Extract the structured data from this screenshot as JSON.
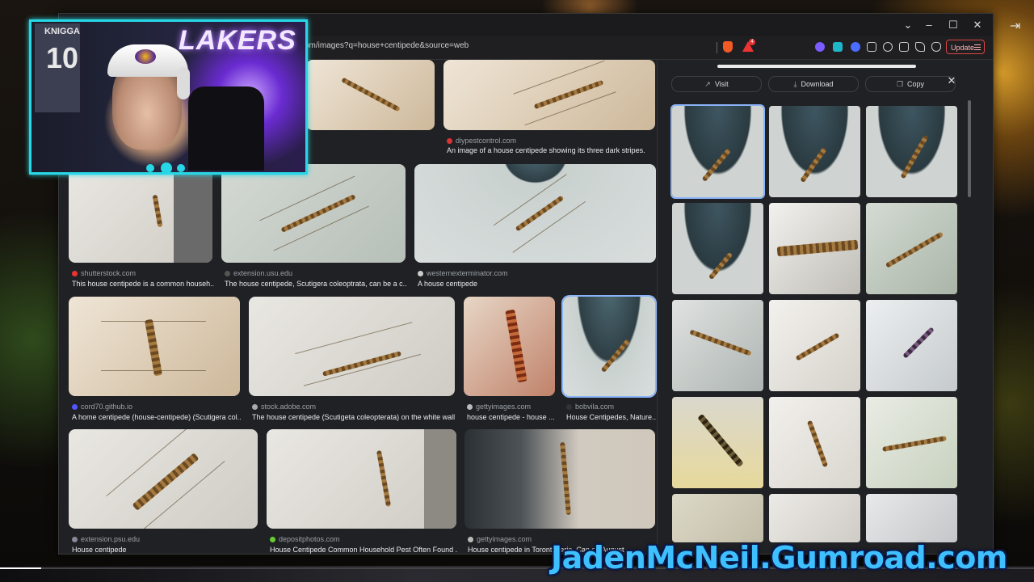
{
  "browser": {
    "url": "om/images?q=house+centipede&source=web",
    "update_label": "Update",
    "alert_count": "4"
  },
  "grid": {
    "rows": [
      [
        {
          "source": "diypestcontrol.com",
          "caption": "An image of a house centipede showing its three dark stripes."
        }
      ],
      [
        {
          "source": "shutterstock.com",
          "caption": "This house centipede is a common househ..."
        },
        {
          "source": "extension.usu.edu",
          "caption": "The house centipede, Scutigera coleoptrata, can be a c..."
        },
        {
          "source": "westernexterminator.com",
          "caption": "A house centipede"
        }
      ],
      [
        {
          "source": "cord70.github.io",
          "caption": "A home centipede (house-centipede) (Scutigera col..."
        },
        {
          "source": "stock.adobe.com",
          "caption": "The house centipede (Scutigeta coleopterata) on the white wall"
        },
        {
          "source": "gettyimages.com",
          "caption": "house centipede - house ..."
        },
        {
          "source": "bobvila.com",
          "caption": "House Centipedes, Nature..."
        }
      ],
      [
        {
          "source": "extension.psu.edu",
          "caption": "House centipede"
        },
        {
          "source": "depositphotos.com",
          "caption": "House Centipede Common Household Pest Often Found ..."
        },
        {
          "source": "gettyimages.com",
          "caption": "House centipede in Toronto,   ario, Can   on August"
        }
      ]
    ]
  },
  "panel": {
    "visit_label": "Visit",
    "download_label": "Download",
    "copy_label": "Copy"
  },
  "overlay": {
    "jersey_name": "KNIGGA",
    "jersey_number": "10",
    "sign_text": "LAKERS",
    "banner_text": "JadenMcNeil.Gumroad.com"
  },
  "player": {
    "progress_fraction": 0.04
  },
  "colors": {
    "accent_cyan": "#27d7e6",
    "banner_blue": "#3ec0ff",
    "selection_blue": "#8ab4f8"
  }
}
